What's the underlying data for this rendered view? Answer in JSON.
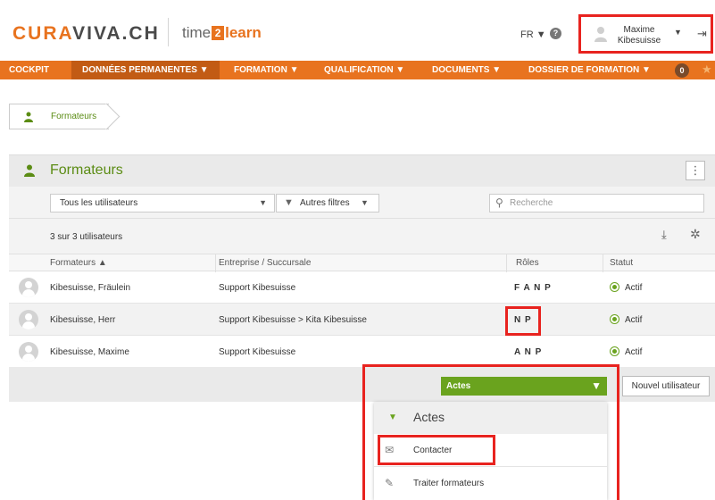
{
  "header": {
    "brand_a": "CURA",
    "brand_b": "VIVA",
    "brand_c": ".CH",
    "t2l_a": "time",
    "t2l_b": "2",
    "t2l_c": "learn",
    "language": "FR ▼",
    "help": "?",
    "user_first": "Maxime",
    "user_last": "Kibesuisse",
    "user_caret": "▼",
    "logout": "⇥"
  },
  "nav": {
    "items": [
      {
        "label": "COCKPIT"
      },
      {
        "label": "DONNÉES PERMANENTES ▼"
      },
      {
        "label": "FORMATION ▼"
      },
      {
        "label": "QUALIFICATION ▼"
      },
      {
        "label": "DOCUMENTS ▼"
      },
      {
        "label": "DOSSIER DE FORMATION ▼"
      }
    ],
    "badge": "0",
    "star": "★"
  },
  "breadcrumb": {
    "label": "Formateurs"
  },
  "panel": {
    "title": "Formateurs",
    "menu": "⋮",
    "select_value": "Tous les utilisateurs",
    "select_caret": "▼",
    "filter_label": "Autres filtres",
    "filter_caret": "▼",
    "search_placeholder": "Recherche",
    "count": "3 sur 3 utilisateurs",
    "export_icon": "⤓",
    "settings_icon": "✲"
  },
  "table": {
    "headers": {
      "name": "Formateurs ▲",
      "company": "Entreprise / Succursale",
      "roles": "Rôles",
      "status": "Statut"
    },
    "rows": [
      {
        "name": "Kibesuisse, Fräulein",
        "company": "Support Kibesuisse",
        "roles": "F A N P",
        "status": "Actif"
      },
      {
        "name": "Kibesuisse, Herr",
        "company": "Support Kibesuisse > Kita Kibesuisse",
        "roles": "N P",
        "status": "Actif"
      },
      {
        "name": "Kibesuisse, Maxime",
        "company": "Support Kibesuisse",
        "roles": "A N P",
        "status": "Actif"
      }
    ]
  },
  "footer": {
    "actions_label": "Actes",
    "actions_caret": "▼",
    "new_user": "Nouvel utilisateur"
  },
  "dropdown": {
    "caret": "▼",
    "title": "Actes",
    "items": [
      {
        "label": "Contacter",
        "icon": "✉"
      },
      {
        "label": "Traiter formateurs",
        "icon": "✎"
      }
    ]
  },
  "colors": {
    "brand_orange": "#e8731f",
    "accent_green": "#6aa31e",
    "highlight_red": "#e8231f"
  }
}
